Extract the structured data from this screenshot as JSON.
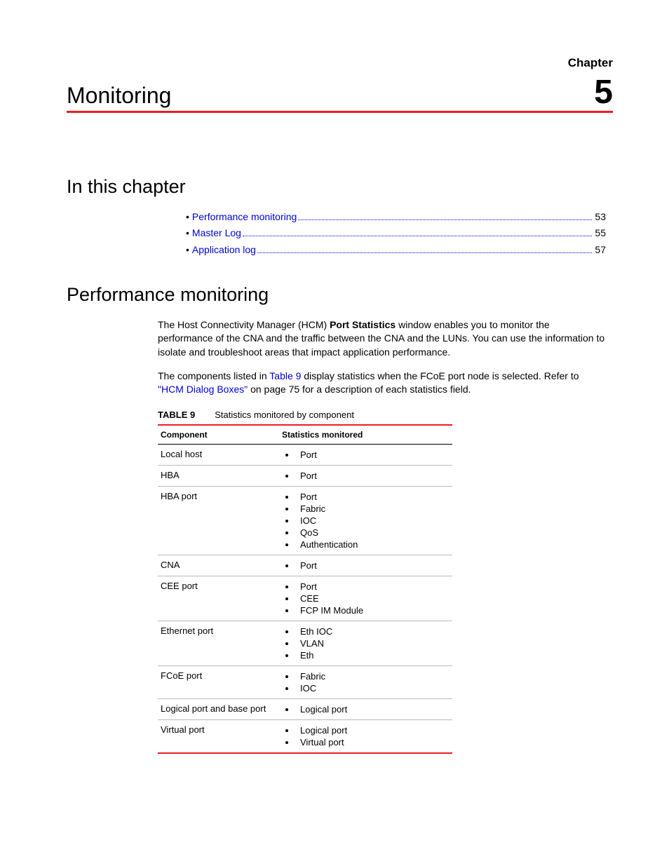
{
  "chapter": {
    "label": "Chapter",
    "number": "5",
    "title": "Monitoring"
  },
  "sections": {
    "in_this_chapter": "In this chapter",
    "performance_monitoring": "Performance monitoring"
  },
  "toc": [
    {
      "label": "Performance monitoring",
      "page": "53"
    },
    {
      "label": "Master Log",
      "page": "55"
    },
    {
      "label": "Application log",
      "page": "57"
    }
  ],
  "paragraphs": {
    "p1_a": "The Host Connectivity Manager (HCM) ",
    "p1_bold": "Port Statistics",
    "p1_b": " window enables you to monitor the performance of the CNA and the traffic between the CNA and the LUNs. You can use the information to isolate and troubleshoot areas that impact application performance.",
    "p2_a": "The components listed in ",
    "p2_link1": "Table 9",
    "p2_b": " display statistics when the FCoE port node is selected. Refer to ",
    "p2_link2": "\"HCM Dialog Boxes\"",
    "p2_c": " on page 75 for a description of each statistics field."
  },
  "table": {
    "number": "TABLE 9",
    "caption": "Statistics monitored by component",
    "headers": {
      "component": "Component",
      "stats": "Statistics monitored"
    },
    "rows": [
      {
        "component": "Local host",
        "stats": [
          "Port"
        ]
      },
      {
        "component": "HBA",
        "stats": [
          "Port"
        ]
      },
      {
        "component": "HBA port",
        "stats": [
          "Port",
          "Fabric",
          "IOC",
          "QoS",
          "Authentication"
        ]
      },
      {
        "component": "CNA",
        "stats": [
          "Port"
        ]
      },
      {
        "component": "CEE port",
        "stats": [
          "Port",
          "CEE",
          "FCP IM Module"
        ]
      },
      {
        "component": "Ethernet port",
        "stats": [
          "Eth IOC",
          "VLAN",
          "Eth"
        ]
      },
      {
        "component": "FCoE port",
        "stats": [
          "Fabric",
          "IOC"
        ]
      },
      {
        "component": "Logical port and base port",
        "stats": [
          "Logical port"
        ]
      },
      {
        "component": "Virtual port",
        "stats": [
          "Logical port",
          "Virtual port"
        ]
      }
    ]
  }
}
